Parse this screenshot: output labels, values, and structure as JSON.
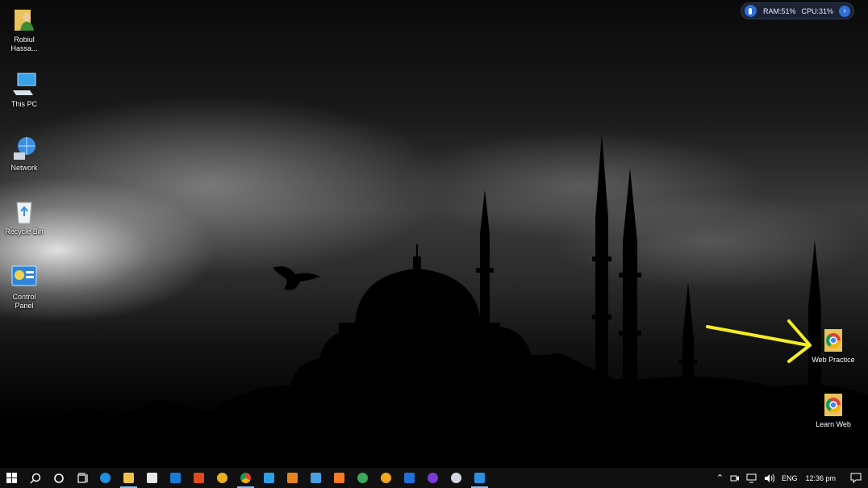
{
  "desktop_icons_left": [
    {
      "label": "Robiul Hassa...",
      "icon": "user-folder-icon"
    },
    {
      "label": "This PC",
      "icon": "computer-icon"
    },
    {
      "label": "Network",
      "icon": "network-icon"
    },
    {
      "label": "Recycle Bin",
      "icon": "recycle-bin-icon"
    },
    {
      "label": "Control Panel",
      "icon": "control-panel-icon"
    }
  ],
  "desktop_icons_right": [
    {
      "label": "Web Practice",
      "icon": "chrome-folder-icon"
    },
    {
      "label": "Learn Web",
      "icon": "chrome-folder-icon"
    }
  ],
  "system_widget": {
    "ram": "RAM:51%",
    "cpu": "CPU:31%"
  },
  "taskbar": {
    "apps": [
      "start-icon",
      "search-icon",
      "cortana-icon",
      "task-view-icon",
      "edge-icon",
      "file-explorer-icon",
      "store-icon",
      "mail-icon",
      "office-icon",
      "app-yellow-icon",
      "chrome-icon",
      "app-blue-icon",
      "app-orange-icon",
      "remote-desktop-icon",
      "xampp-icon",
      "app-green-icon",
      "app-chrome-canary-icon",
      "vpn-shield-icon",
      "github-icon",
      "app-bird-icon",
      "vscode-icon"
    ],
    "tray": {
      "language": "ENG",
      "time": "12:36 pm"
    }
  },
  "colors": {
    "taskbar_bg": "#101010",
    "annotation_arrow": "#f5ee22",
    "accent": "#2f6fd6"
  }
}
